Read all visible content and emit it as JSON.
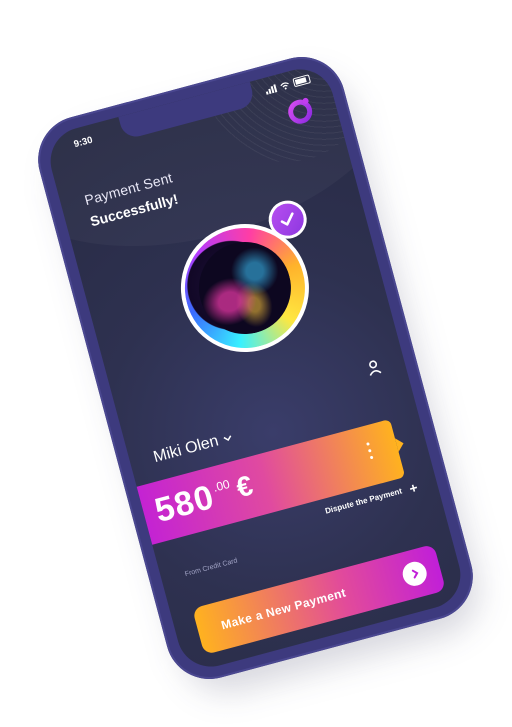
{
  "status": {
    "time": "9:30"
  },
  "header": {
    "line1": "Payment Sent",
    "line2": "Successfully!"
  },
  "recipient": {
    "name": "Miki Olen"
  },
  "payment": {
    "amount_integer": "580",
    "amount_decimal": ".00",
    "currency": "€",
    "dispute_label": "Dispute the Payment",
    "source_label": "From Credit Card"
  },
  "cta": {
    "label": "Make a New Payment"
  },
  "colors": {
    "phone_frame": "#3d3a7e",
    "screen_bg": "#2b2e4a",
    "gradient_pink": "#c11fd8",
    "gradient_orange": "#ffb21f",
    "accent_purple": "#a145ea"
  },
  "icons": {
    "logo": "brand-ring-icon",
    "verified": "check-icon",
    "profile": "person-icon",
    "name_dropdown": "chevron-down-icon",
    "more": "more-vertical-icon",
    "dispute": "plus-icon",
    "cta": "chevron-right-icon"
  }
}
